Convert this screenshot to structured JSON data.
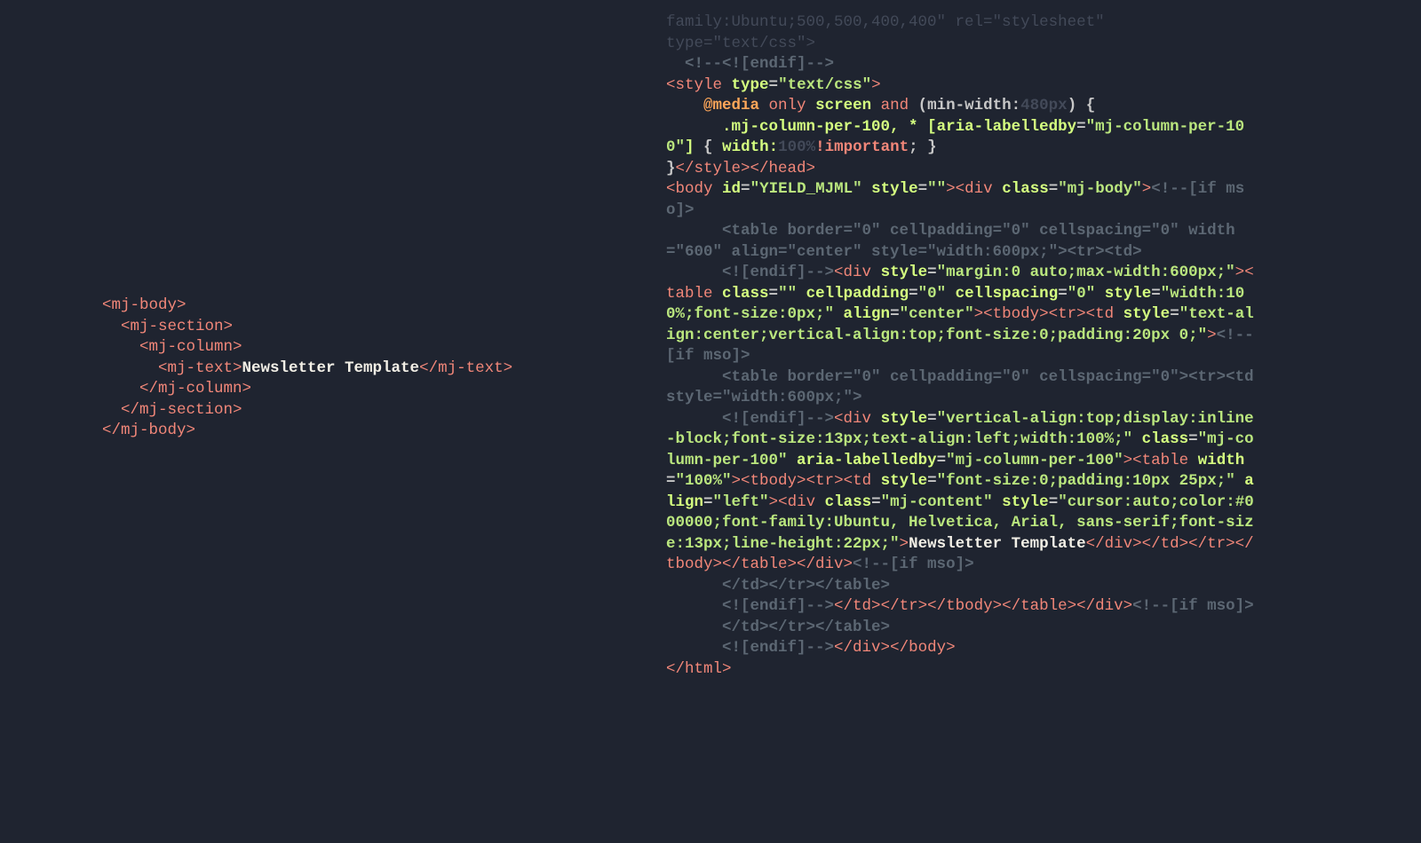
{
  "left": {
    "mj_body_open": "<mj-body>",
    "mj_section_open": "<mj-section>",
    "mj_column_open": "<mj-column>",
    "mj_text_open": "<mj-text>",
    "newsletter": "Newsletter Template",
    "mj_text_close": "</mj-text>",
    "mj_column_close": "</mj-column>",
    "mj_section_close": "</mj-section>",
    "mj_body_close": "</mj-body>"
  },
  "right": {
    "dim_line1": "family:Ubuntu;500,500,400,400\" rel=\"stylesheet\"",
    "dim_line1b": "type=",
    "dim_line1c": "\"text/css\"",
    "dim_line1d": ">",
    "comm_endif1": "<!--<![endif]-->",
    "style_open": "<style",
    "type_attr": "type",
    "type_val": "\"text/css\"",
    "gt": ">",
    "at_media": "@media",
    "only": "only",
    "screen": "screen",
    "and": "and",
    "minwidth": "(min-width:",
    "px480": "480px",
    "brace_open": ") {",
    "mj_col_sel": ".mj-column-per-100, * [",
    "aria_attr": "aria-labelledby",
    "aria_val": "\"mj-column-per-100\"",
    "sel_close": "]",
    "rule_open": "{ ",
    "width_prop": "width:",
    "pct100": "100%",
    "important": "!important",
    "rule_close_semi": ";",
    "rule_close": " }",
    "brace_close": "}",
    "style_close": "</style>",
    "head_close": "</head>",
    "body_open": "<body",
    "id_attr": "id",
    "id_val": "\"YIELD_MJML\"",
    "style_attr": "style",
    "style_empty": "\"\"",
    "div_open": "<div",
    "class_attr": "class",
    "mjbody_val": "\"mj-body\"",
    "comm_ifmso_open": "<!--[if mso]>",
    "mso_table1a": "      <table border=\"0\" cellpadding=\"0\" cellspacing=\"0\" width=\"600\" align=\"center\" style=\"width:600px;\"><tr><td>",
    "mso_endif1": "      <![endif]-->",
    "margin_val": "\"margin:0 auto;max-width:600px;\"",
    "table_open": "<table",
    "class_empty": "\"\"",
    "cellpad_attr": "cellpadding",
    "zero_val": "\"0\"",
    "cellspace_attr": "cellspacing",
    "tblstyle_val": "\"width:100%;font-size:0px;\"",
    "align_attr": "align",
    "center_val": "\"center\"",
    "tbody_open": "<tbody>",
    "tr_open": "<tr>",
    "td_open": "<td",
    "tdstyle_val": "\"text-align:center;vertical-align:top;font-size:0;padding:20px 0;\"",
    "comm_ifmso2": "<!--[if mso]>",
    "mso_table2": "      <table border=\"0\" cellpadding=\"0\" cellspacing=\"0\"><tr><td style=\"width:600px;\">",
    "mso_endif2": "      <![endif]-->",
    "div2_style": "\"vertical-align:top;display:inline-block;font-size:13px;text-align:left;width:100%;\"",
    "mjcol_val": "\"mj-column-per-100\"",
    "arialab_attr": "aria-labelledby",
    "width_attr": "width",
    "pct100_val": "\"100%\"",
    "td2_style": "\"font-size:0;padding:10px 25px;\"",
    "left_val": "\"left\"",
    "mjcontent_val": "\"mj-content\"",
    "div3_style": "\"cursor:auto;color:#000000;font-family:Ubuntu, Helvetica, Arial, sans-serif;font-size:13px;line-height:22px;\"",
    "newsletter": "Newsletter Template",
    "div_close": "</div>",
    "td_close": "</td>",
    "tr_close": "</tr>",
    "tbody_close": "</tbody>",
    "table_close": "</table>",
    "comm_ifmso3": "<!--[if mso]>",
    "mso_close1": "      </td></tr></table>",
    "mso_endif3": "      <![endif]-->",
    "comm_ifmso4": "<!--[if mso]>",
    "mso_close2": "      </td></tr></table>",
    "mso_endif4": "      <![endif]-->",
    "body_close": "</body>",
    "html_close": "</html>"
  }
}
